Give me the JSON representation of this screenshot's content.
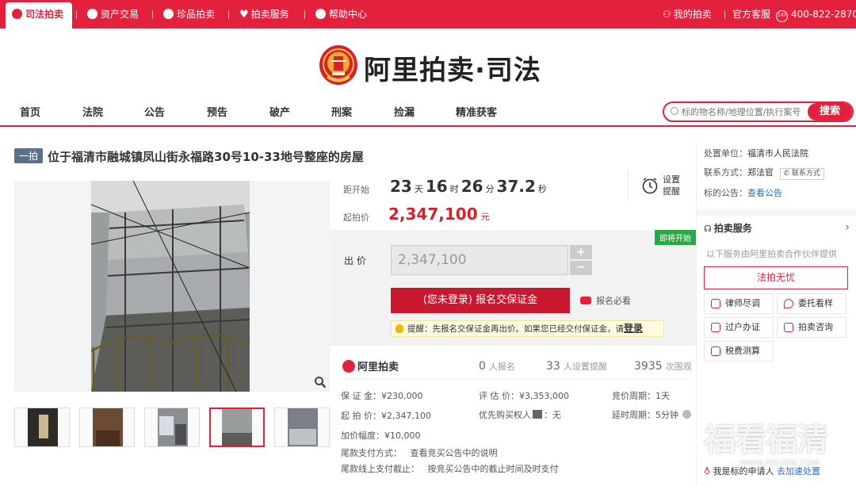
{
  "topbar": {
    "tabs": [
      {
        "label": "司法拍卖",
        "icon": "judicial-icon"
      },
      {
        "label": "资产交易",
        "icon": "asset-icon"
      },
      {
        "label": "珍品拍卖",
        "icon": "treasure-icon"
      },
      {
        "label": "拍卖服务",
        "icon": "heart-icon"
      },
      {
        "label": "帮助中心",
        "icon": "help-icon"
      }
    ],
    "my_auction": "我的拍卖",
    "customer_service": "官方客服",
    "hotline": "400-822-2870",
    "hotline_badge": "24h"
  },
  "logo": {
    "text": "阿里拍卖·司法"
  },
  "nav": {
    "items": [
      "首页",
      "法院",
      "公告",
      "预告",
      "破产",
      "刑案",
      "捡漏",
      "精准获客"
    ],
    "search_placeholder": "标的物名称/地理位置/执行案号",
    "search_button": "搜索"
  },
  "item": {
    "tag": "一拍",
    "title": "位于福清市融城镇凤山街永福路30号10-33地号整座的房屋"
  },
  "countdown": {
    "label": "距开始",
    "days": "23",
    "days_unit": "天",
    "hours": "16",
    "hours_unit": "时",
    "minutes": "26",
    "minutes_unit": "分",
    "seconds": "37.2",
    "seconds_unit": "秒",
    "reminder_label": "设置提醒"
  },
  "start_price": {
    "label": "起拍价",
    "value": "2,347,100",
    "unit": "元"
  },
  "bid": {
    "badge": "即将开始",
    "label": "出 价",
    "input_value": "2,347,100",
    "plus": "+",
    "minus": "−",
    "register_button": "(您未登录) 报名交保证金",
    "must_read": "报名必看",
    "tip_prefix": "提醒：先报名交保证金再出价。如果您已经交付保证金，请",
    "tip_link": "登录"
  },
  "stats": {
    "brand": "阿里拍卖",
    "signups_num": "0",
    "signups_label": "人报名",
    "reminders_num": "33",
    "reminders_label": "人设置提醒",
    "views_num": "3935",
    "views_label": "次围观"
  },
  "details": {
    "deposit": "保 证 金：¥230,000",
    "appraisal": "评 估 价：¥3,353,000",
    "bid_cycle": "竞价周期：1天",
    "start_price": "起 拍 价：¥2,347,100",
    "priority": "优先购买权人",
    "priority_value": "：无",
    "delay_cycle": "延时周期：5分钟",
    "increment": "加价幅度：¥10,000",
    "balance_method": "尾款支付方式：   查看竞买公告中的说明",
    "balance_deadline": "尾款线上支付截止：   按竞买公告中的截止时间及时支付"
  },
  "court": {
    "unit_label": "处置单位：",
    "unit_value": "福清市人民法院",
    "contact_label": "联系方式：",
    "contact_value": "郑法官",
    "contact_button": "联系方式",
    "notice_label": "标的公告：",
    "notice_link": "查看公告"
  },
  "services": {
    "title": "拍卖服务",
    "subtitle": "以下服务由阿里拍卖合作伙伴提供",
    "featured": "法拍无忧",
    "items": [
      "律师尽调",
      "委托看样",
      "过户办证",
      "拍卖咨询",
      "税费测算"
    ]
  },
  "applicant": {
    "label": "我是标的申请人",
    "link": "去加速处置"
  },
  "watermark": {
    "cn": "福看福清",
    "url": "WWW.FOLOOK.COM"
  },
  "colors": {
    "brand": "#e4213c",
    "price": "#d6202a"
  }
}
